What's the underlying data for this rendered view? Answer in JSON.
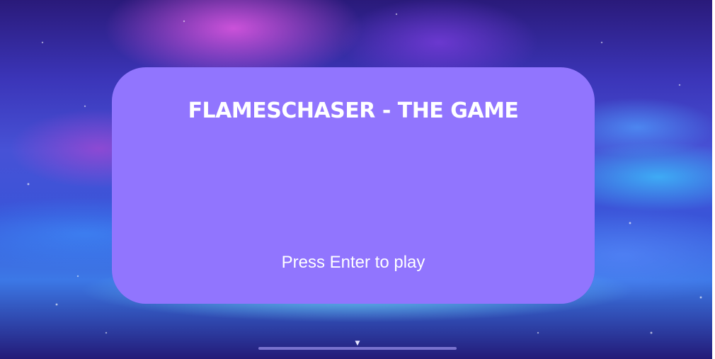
{
  "game": {
    "title": "FLAMESCHASER - THE GAME",
    "prompt": "Press Enter to play"
  },
  "scroll": {
    "arrow_icon": "triangle-down-icon",
    "arrow_glyph": "▼"
  },
  "colors": {
    "dialog_bg": "#9175fe",
    "text": "#ffffff"
  }
}
